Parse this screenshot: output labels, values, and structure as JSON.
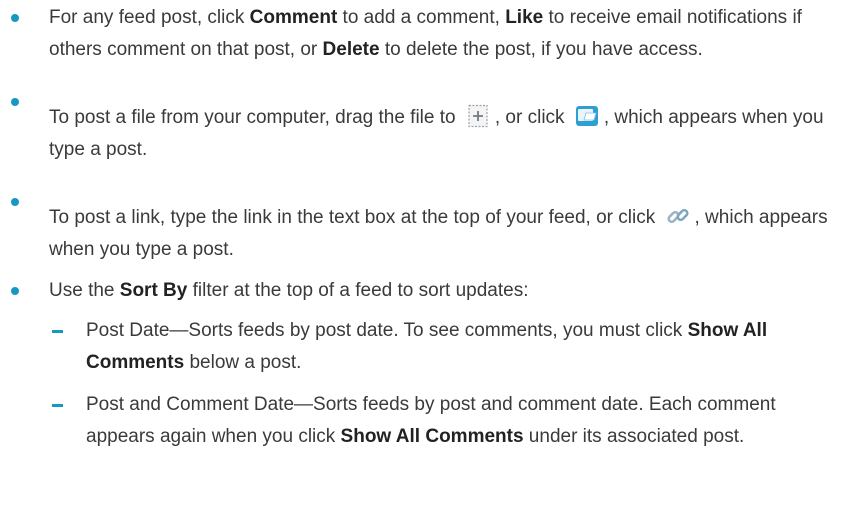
{
  "bullets": [
    {
      "pre": "For any feed post, click ",
      "b1": "Comment",
      "mid1": " to add a comment, ",
      "b2": "Like",
      "mid2": " to receive email notifications if others comment on that post, or ",
      "b3": "Delete",
      "post": " to delete the post, if you have access."
    },
    {
      "pre": "To post a file from your computer, drag the file to ",
      "mid": ", or click ",
      "post": ", which appears when you type a post."
    },
    {
      "pre": "To post a link, type the link in the text box at the top of your feed, or click ",
      "post": ", which appears when you type a post."
    },
    {
      "pre": "Use the ",
      "b1": "Sort By",
      "post": " filter at the top of a feed to sort updates:"
    }
  ],
  "sub_items": [
    {
      "pre": "Post Date—Sorts feeds by post date. To see comments, you must click ",
      "b1": "Show All Comments",
      "post": " below a post."
    },
    {
      "pre": "Post and Comment Date—Sorts feeds by post and comment date. Each comment appears again when you click ",
      "b1": "Show All Comments",
      "post": " under its associated post."
    }
  ],
  "icons": {
    "drop_zone": "file-drop-zone-icon",
    "file_upload": "file-upload-icon",
    "link": "link-icon"
  },
  "colors": {
    "bullet": "#1798c1",
    "text": "#3a3a3a"
  }
}
